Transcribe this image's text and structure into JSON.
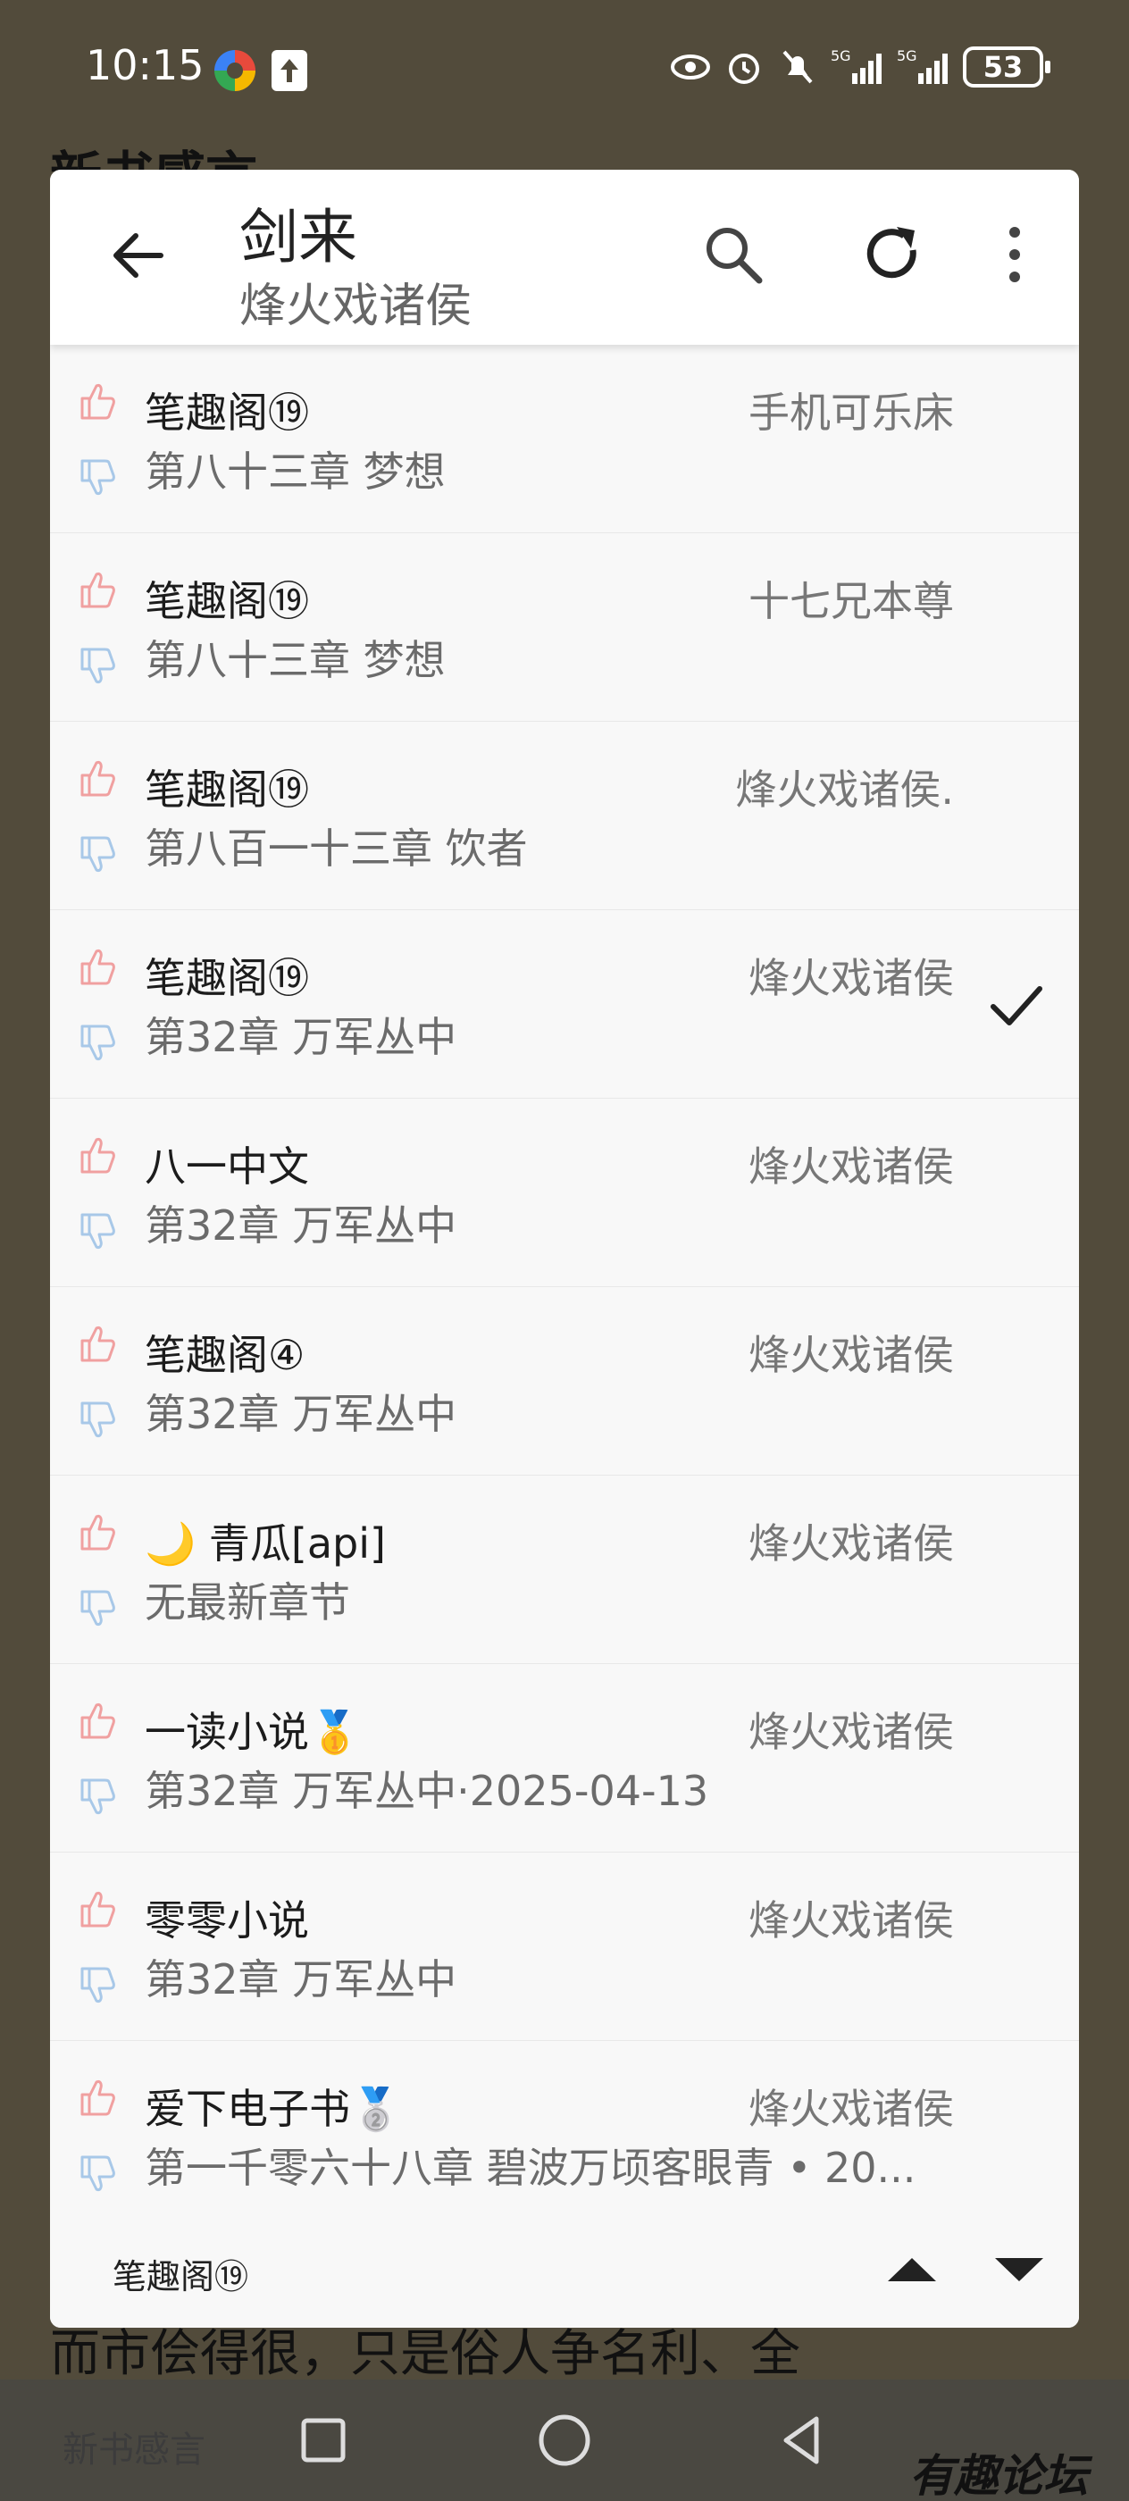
{
  "status_bar": {
    "time": "10:15",
    "battery": "53",
    "icons": [
      "eye-icon",
      "alarm-icon",
      "bell-muted-icon",
      "signal-5g-icon",
      "signal-5g-icon-2"
    ]
  },
  "background": {
    "title": "新书感言",
    "bottom_text": "而市侩得很，只是俗人争名利、全",
    "nav_left_text": "新书感言"
  },
  "dialog": {
    "title": "剑来",
    "subtitle": "烽火戏诸侯",
    "sources": [
      {
        "name": "笔趣阁⑲",
        "chapter": "第八十三章 梦想",
        "author": "手机可乐床",
        "selected": false
      },
      {
        "name": "笔趣阁⑲",
        "chapter": "第八十三章 梦想",
        "author": "十七兄本尊",
        "selected": false
      },
      {
        "name": "笔趣阁⑲",
        "chapter": "第八百一十三章 饮者",
        "author": "烽火戏诸侯.",
        "selected": false
      },
      {
        "name": "笔趣阁⑲",
        "chapter": "第32章 万军丛中",
        "author": "烽火戏诸侯",
        "selected": true
      },
      {
        "name": "八一中文",
        "chapter": "第32章 万军丛中",
        "author": "烽火戏诸侯",
        "selected": false
      },
      {
        "name": "笔趣阁④",
        "chapter": "第32章 万军丛中",
        "author": "烽火戏诸侯",
        "selected": false
      },
      {
        "name": "🌙 青瓜[api]",
        "chapter": "无最新章节",
        "author": "烽火戏诸侯",
        "selected": false
      },
      {
        "name": "一读小说🥇",
        "chapter": "第32章 万军丛中·2025-04-13",
        "author": "烽火戏诸侯",
        "selected": false
      },
      {
        "name": "零零小说",
        "chapter": "第32章 万军丛中",
        "author": "烽火戏诸侯",
        "selected": false
      },
      {
        "name": "爱下电子书🥈",
        "chapter": "第一千零六十八章 碧波万顷客眼青 • 20...",
        "author": "烽火戏诸侯",
        "selected": false
      }
    ],
    "footer_label": "笔趣阁⑲"
  },
  "watermark": "有趣论坛",
  "colors": {
    "thumb_up": "#f0a0a0",
    "thumb_down": "#a8c8e8",
    "background": "#524b3b"
  }
}
